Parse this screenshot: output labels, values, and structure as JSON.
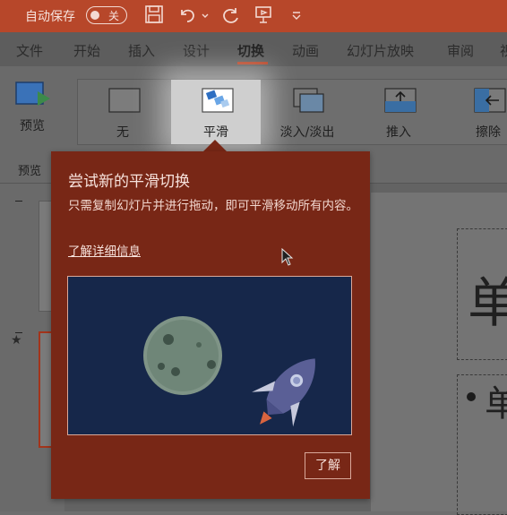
{
  "titlebar": {
    "autosave_label": "自动保存",
    "autosave_state": "关",
    "icons": [
      "save-icon",
      "undo-icon",
      "undo-dropdown-icon",
      "redo-icon",
      "present-icon",
      "customize-icon"
    ]
  },
  "tabs": [
    {
      "label": "文件"
    },
    {
      "label": "开始"
    },
    {
      "label": "插入"
    },
    {
      "label": "设计"
    },
    {
      "label": "切换",
      "active": true
    },
    {
      "label": "动画"
    },
    {
      "label": "幻灯片放映"
    },
    {
      "label": "审阅"
    },
    {
      "label": "视"
    }
  ],
  "ribbon": {
    "preview_label": "预览",
    "preview_group_label": "预览",
    "transitions": [
      {
        "label": "无",
        "icon": "none-transition-icon"
      },
      {
        "label": "平滑",
        "icon": "morph-transition-icon",
        "selected": true
      },
      {
        "label": "淡入/淡出",
        "icon": "fade-transition-icon"
      },
      {
        "label": "推入",
        "icon": "push-transition-icon"
      },
      {
        "label": "擦除",
        "icon": "wipe-transition-icon"
      }
    ]
  },
  "slide": {
    "title_char": "单",
    "bullet_char": "单"
  },
  "tooltip": {
    "title": "尝试新的平滑切换",
    "description": "只需复制幻灯片并进行拖动，即可平滑移动所有内容。",
    "link": "了解详细信息",
    "button": "了解",
    "media": "moon-and-rocket-illustration"
  },
  "colors": {
    "accent": "#b7472a",
    "tooltip_bg": "#782716",
    "media_bg": "#16274a"
  }
}
